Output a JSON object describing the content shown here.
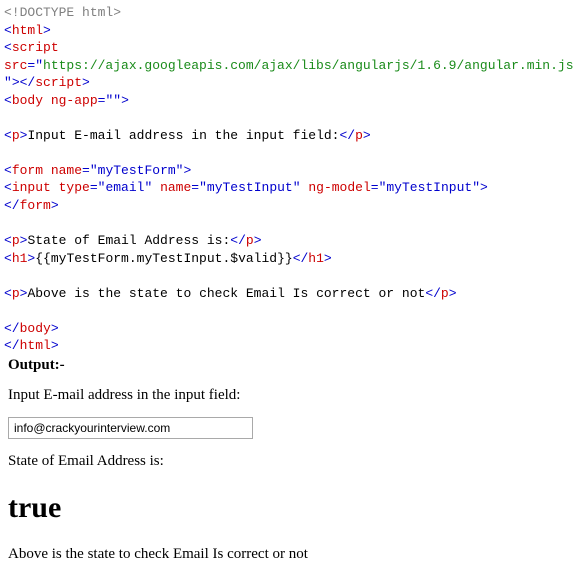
{
  "code": {
    "line1": "<!DOCTYPE html>",
    "html_open_br": "<",
    "html_tag": "html",
    "html_close_br": ">",
    "script_open_br": "<",
    "script_tag": "script",
    "script_attr": " src",
    "eqq": "=\"",
    "script_src": "https://ajax.googleapis.com/ajax/libs/angularjs/1.6.9/angular.min.js",
    "qclose": "\"",
    "script_close": "></",
    "script_gt": ">",
    "body_open_br": "<",
    "body_tag": "body",
    "body_attr": " ng-app",
    "body_val": "",
    "empty_line": " ",
    "p_open_br": "<",
    "p_tag": "p",
    "p_close_br": ">",
    "p1_text": "Input E-mail address in the input field:",
    "p_end_br": "</",
    "form_open_br": "<",
    "form_tag": "form",
    "form_attr_name": " name",
    "form_name_val": "myTestForm",
    "input_open_br": "<",
    "input_tag": "input",
    "input_attr_type": " type",
    "input_type_val": "email",
    "input_attr_name": " name",
    "input_name_val": "myTestInput",
    "input_attr_model": " ng-model",
    "input_model_val": "myTestInput",
    "form_close_br": "</",
    "p2_text": "State of Email Address is:",
    "h1_open_br": "<",
    "h1_tag": "h1",
    "h1_close_br": ">",
    "h1_text": "{{myTestForm.myTestInput.$valid}}",
    "h1_end_br": "</",
    "p3_text": "Above is the state to check Email Is correct or not",
    "body_end_br": "</",
    "html_end_br": "</"
  },
  "output": {
    "label": "Output:-",
    "p1": "Input E-mail address in the input field:",
    "input_value": "info@crackyourinterview.com",
    "p2": "State of Email Address is:",
    "result": "true",
    "p3": "Above is the state to check Email Is correct or not"
  }
}
